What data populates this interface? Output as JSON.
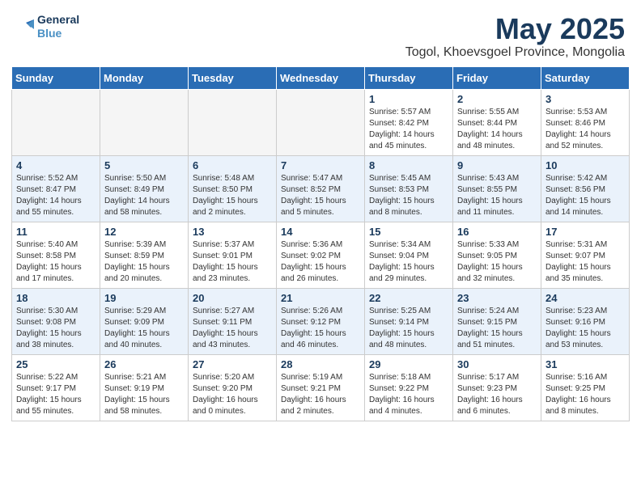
{
  "header": {
    "logo_line1": "General",
    "logo_line2": "Blue",
    "main_title": "May 2025",
    "subtitle": "Togol, Khoevsgoel Province, Mongolia"
  },
  "weekdays": [
    "Sunday",
    "Monday",
    "Tuesday",
    "Wednesday",
    "Thursday",
    "Friday",
    "Saturday"
  ],
  "weeks": [
    [
      {
        "day": "",
        "info": ""
      },
      {
        "day": "",
        "info": ""
      },
      {
        "day": "",
        "info": ""
      },
      {
        "day": "",
        "info": ""
      },
      {
        "day": "1",
        "info": "Sunrise: 5:57 AM\nSunset: 8:42 PM\nDaylight: 14 hours\nand 45 minutes."
      },
      {
        "day": "2",
        "info": "Sunrise: 5:55 AM\nSunset: 8:44 PM\nDaylight: 14 hours\nand 48 minutes."
      },
      {
        "day": "3",
        "info": "Sunrise: 5:53 AM\nSunset: 8:46 PM\nDaylight: 14 hours\nand 52 minutes."
      }
    ],
    [
      {
        "day": "4",
        "info": "Sunrise: 5:52 AM\nSunset: 8:47 PM\nDaylight: 14 hours\nand 55 minutes."
      },
      {
        "day": "5",
        "info": "Sunrise: 5:50 AM\nSunset: 8:49 PM\nDaylight: 14 hours\nand 58 minutes."
      },
      {
        "day": "6",
        "info": "Sunrise: 5:48 AM\nSunset: 8:50 PM\nDaylight: 15 hours\nand 2 minutes."
      },
      {
        "day": "7",
        "info": "Sunrise: 5:47 AM\nSunset: 8:52 PM\nDaylight: 15 hours\nand 5 minutes."
      },
      {
        "day": "8",
        "info": "Sunrise: 5:45 AM\nSunset: 8:53 PM\nDaylight: 15 hours\nand 8 minutes."
      },
      {
        "day": "9",
        "info": "Sunrise: 5:43 AM\nSunset: 8:55 PM\nDaylight: 15 hours\nand 11 minutes."
      },
      {
        "day": "10",
        "info": "Sunrise: 5:42 AM\nSunset: 8:56 PM\nDaylight: 15 hours\nand 14 minutes."
      }
    ],
    [
      {
        "day": "11",
        "info": "Sunrise: 5:40 AM\nSunset: 8:58 PM\nDaylight: 15 hours\nand 17 minutes."
      },
      {
        "day": "12",
        "info": "Sunrise: 5:39 AM\nSunset: 8:59 PM\nDaylight: 15 hours\nand 20 minutes."
      },
      {
        "day": "13",
        "info": "Sunrise: 5:37 AM\nSunset: 9:01 PM\nDaylight: 15 hours\nand 23 minutes."
      },
      {
        "day": "14",
        "info": "Sunrise: 5:36 AM\nSunset: 9:02 PM\nDaylight: 15 hours\nand 26 minutes."
      },
      {
        "day": "15",
        "info": "Sunrise: 5:34 AM\nSunset: 9:04 PM\nDaylight: 15 hours\nand 29 minutes."
      },
      {
        "day": "16",
        "info": "Sunrise: 5:33 AM\nSunset: 9:05 PM\nDaylight: 15 hours\nand 32 minutes."
      },
      {
        "day": "17",
        "info": "Sunrise: 5:31 AM\nSunset: 9:07 PM\nDaylight: 15 hours\nand 35 minutes."
      }
    ],
    [
      {
        "day": "18",
        "info": "Sunrise: 5:30 AM\nSunset: 9:08 PM\nDaylight: 15 hours\nand 38 minutes."
      },
      {
        "day": "19",
        "info": "Sunrise: 5:29 AM\nSunset: 9:09 PM\nDaylight: 15 hours\nand 40 minutes."
      },
      {
        "day": "20",
        "info": "Sunrise: 5:27 AM\nSunset: 9:11 PM\nDaylight: 15 hours\nand 43 minutes."
      },
      {
        "day": "21",
        "info": "Sunrise: 5:26 AM\nSunset: 9:12 PM\nDaylight: 15 hours\nand 46 minutes."
      },
      {
        "day": "22",
        "info": "Sunrise: 5:25 AM\nSunset: 9:14 PM\nDaylight: 15 hours\nand 48 minutes."
      },
      {
        "day": "23",
        "info": "Sunrise: 5:24 AM\nSunset: 9:15 PM\nDaylight: 15 hours\nand 51 minutes."
      },
      {
        "day": "24",
        "info": "Sunrise: 5:23 AM\nSunset: 9:16 PM\nDaylight: 15 hours\nand 53 minutes."
      }
    ],
    [
      {
        "day": "25",
        "info": "Sunrise: 5:22 AM\nSunset: 9:17 PM\nDaylight: 15 hours\nand 55 minutes."
      },
      {
        "day": "26",
        "info": "Sunrise: 5:21 AM\nSunset: 9:19 PM\nDaylight: 15 hours\nand 58 minutes."
      },
      {
        "day": "27",
        "info": "Sunrise: 5:20 AM\nSunset: 9:20 PM\nDaylight: 16 hours\nand 0 minutes."
      },
      {
        "day": "28",
        "info": "Sunrise: 5:19 AM\nSunset: 9:21 PM\nDaylight: 16 hours\nand 2 minutes."
      },
      {
        "day": "29",
        "info": "Sunrise: 5:18 AM\nSunset: 9:22 PM\nDaylight: 16 hours\nand 4 minutes."
      },
      {
        "day": "30",
        "info": "Sunrise: 5:17 AM\nSunset: 9:23 PM\nDaylight: 16 hours\nand 6 minutes."
      },
      {
        "day": "31",
        "info": "Sunrise: 5:16 AM\nSunset: 9:25 PM\nDaylight: 16 hours\nand 8 minutes."
      }
    ]
  ]
}
